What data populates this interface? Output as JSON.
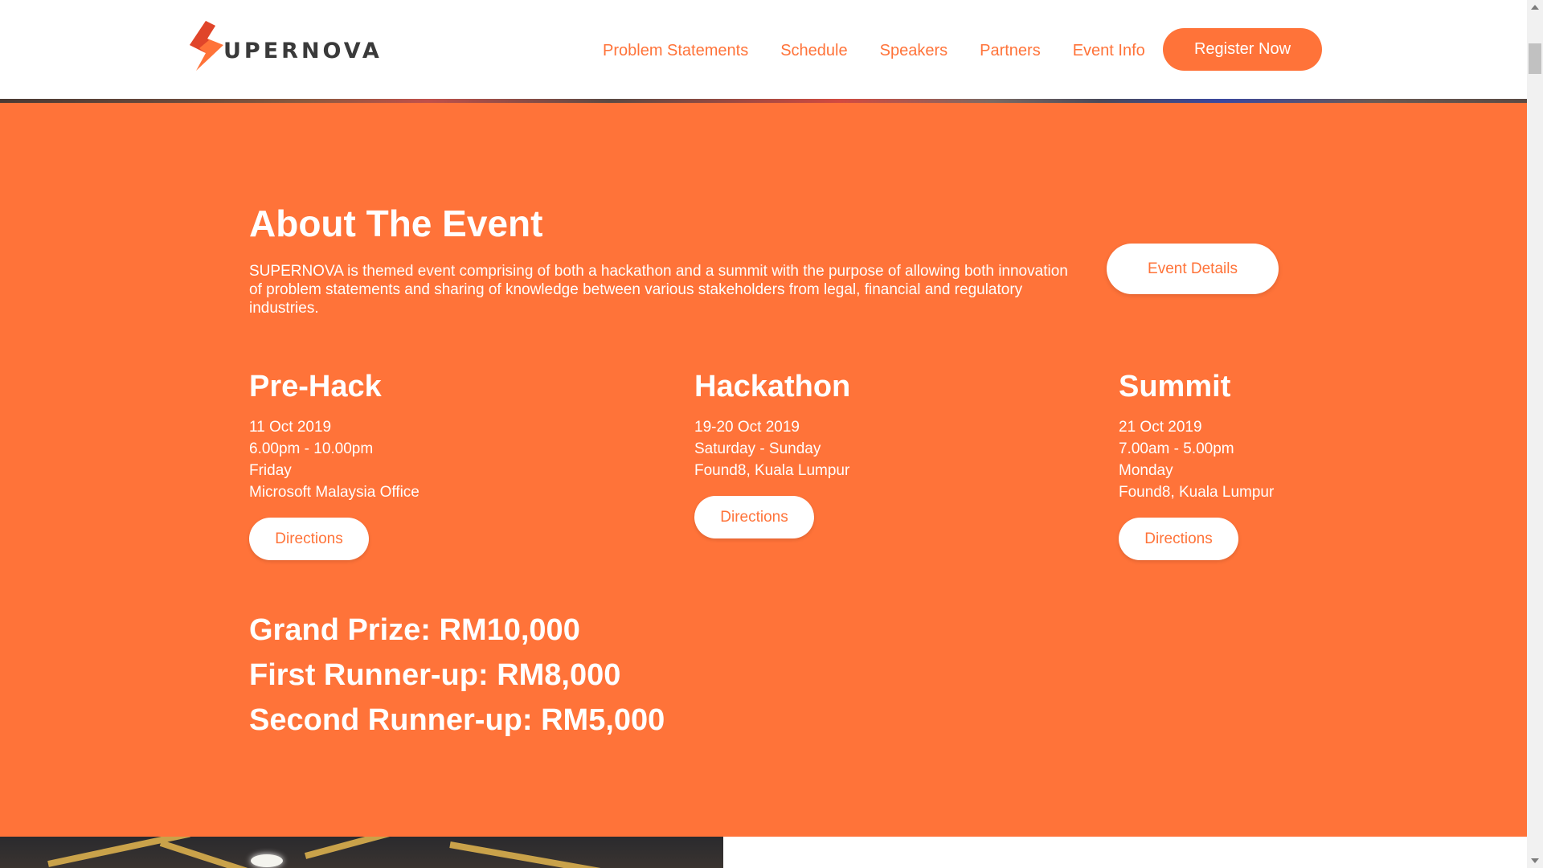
{
  "header": {
    "logo_text": "UPERNOVA",
    "logo_icon": "supernova-s-bolt-icon",
    "nav": [
      {
        "label": "Problem Statements"
      },
      {
        "label": "Schedule"
      },
      {
        "label": "Speakers"
      },
      {
        "label": "Partners"
      },
      {
        "label": "Event Info"
      }
    ],
    "register_label": "Register Now"
  },
  "about": {
    "title": "About The Event",
    "description": "SUPERNOVA is themed event comprising of both a hackathon and a summit with the purpose of allowing both innovation of problem statements and sharing of knowledge between various stakeholders from legal, financial and regulatory industries.",
    "event_details_label": "Event Details",
    "columns": [
      {
        "title": "Pre-Hack",
        "lines": [
          "11 Oct 2019",
          "6.00pm - 10.00pm",
          "Friday",
          "Microsoft Malaysia Office"
        ],
        "directions_label": "Directions"
      },
      {
        "title": "Hackathon",
        "lines": [
          "19-20 Oct 2019",
          "Saturday - Sunday",
          "Found8, Kuala Lumpur"
        ],
        "directions_label": "Directions"
      },
      {
        "title": "Summit",
        "lines": [
          "21 Oct 2019",
          "7.00am - 5.00pm",
          "Monday",
          "Found8, Kuala Lumpur"
        ],
        "directions_label": "Directions"
      }
    ],
    "prizes": [
      "Grand Prize: RM10,000",
      "First Runner-up: RM8,000",
      "Second Runner-up: RM5,000"
    ]
  },
  "colors": {
    "brand_orange": "#ff7339",
    "logo_dark_orange": "#e0452a",
    "text_dark": "#3a3a3a",
    "white": "#ffffff"
  }
}
